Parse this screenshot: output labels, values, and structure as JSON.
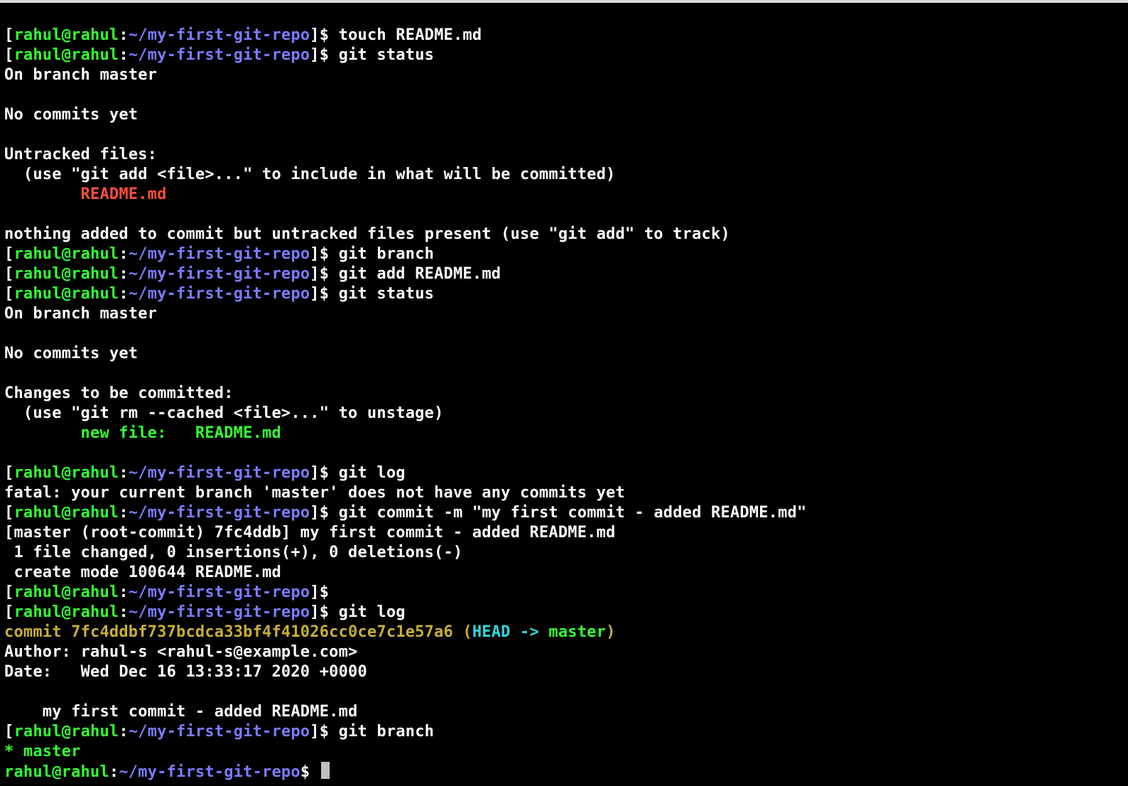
{
  "prompt": {
    "bracket_open": "[",
    "bracket_close": "]",
    "userhost": "rahul@rahul",
    "sep": ":",
    "path": "~/my-first-git-repo",
    "dollar": "$"
  },
  "prompt_last": {
    "userhost": "rahul@rahul",
    "sep": ":",
    "path": "~/my-first-git-repo",
    "dollar": "$"
  },
  "cmd": {
    "touch": "touch README.md",
    "status1": "git status",
    "branch1": "git branch",
    "add": "git add README.md",
    "status2": "git status",
    "log1": "git log",
    "commit": "git commit -m \"my first commit - added README.md\"",
    "empty": "",
    "log2": "git log",
    "branch2": "git branch"
  },
  "status1": {
    "l1": "On branch master",
    "l2": "No commits yet",
    "l3": "Untracked files:",
    "l4": "  (use \"git add <file>...\" to include in what will be committed)",
    "file": "        README.md",
    "l5": "nothing added to commit but untracked files present (use \"git add\" to track)"
  },
  "status2": {
    "l1": "On branch master",
    "l2": "No commits yet",
    "l3": "Changes to be committed:",
    "l4": "  (use \"git rm --cached <file>...\" to unstage)",
    "file": "        new file:   README.md"
  },
  "log1": {
    "err": "fatal: your current branch 'master' does not have any commits yet"
  },
  "commit_out": {
    "l1": "[master (root-commit) 7fc4ddb] my first commit - added README.md",
    "l2": " 1 file changed, 0 insertions(+), 0 deletions(-)",
    "l3": " create mode 100644 README.md"
  },
  "log2": {
    "commit_label": "commit ",
    "hash": "7fc4ddbf737bcdca33bf4f41026cc0ce7c1e57a6",
    "paren_open": " (",
    "head": "HEAD -> ",
    "branch": "master",
    "paren_close": ")",
    "author": "Author: rahul-s <rahul-s@example.com>",
    "date": "Date:   Wed Dec 16 13:33:17 2020 +0000",
    "msg": "    my first commit - added README.md"
  },
  "branch2": {
    "line": "* master"
  }
}
